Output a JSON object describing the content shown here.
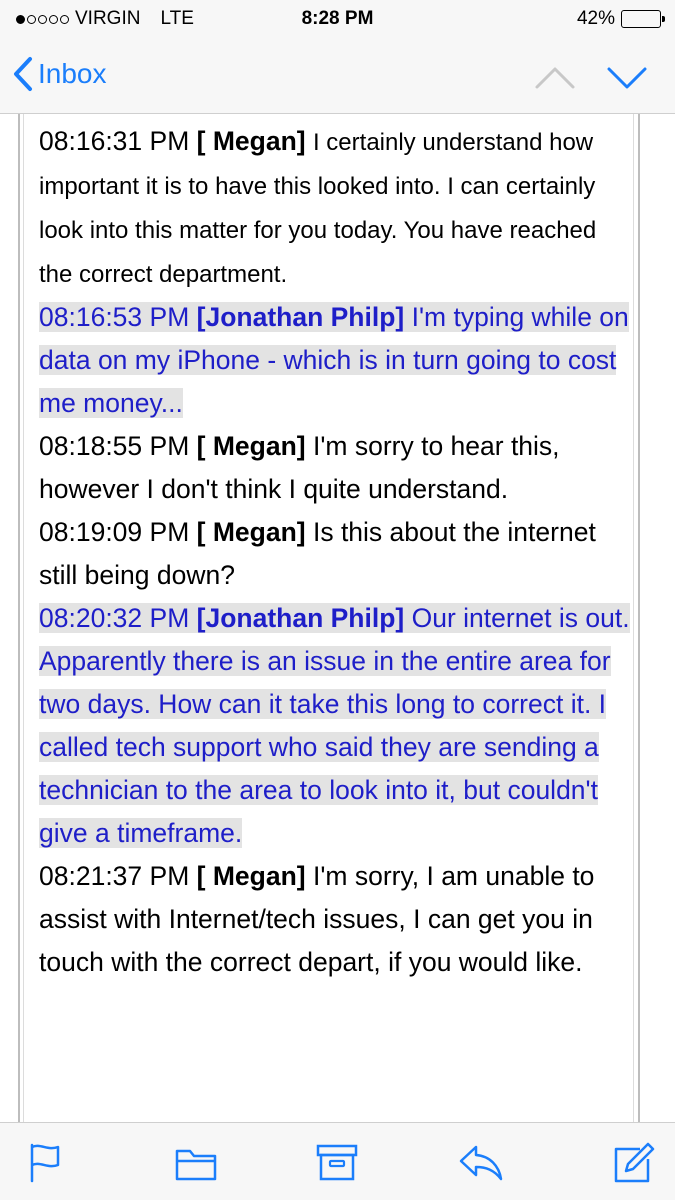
{
  "status_bar": {
    "carrier": "VIRGIN",
    "network": "LTE",
    "time": "8:28 PM",
    "battery": "42%",
    "battery_level": 0.42,
    "signal_bars_filled": 1,
    "signal_bars_total": 5
  },
  "nav": {
    "back_label": "Inbox",
    "back_icon": "chevron-left-icon",
    "up_icon": "chevron-up-icon",
    "down_icon": "chevron-down-icon",
    "accent_color": "#1b7efb"
  },
  "messages": [
    {
      "role": "agent",
      "timestamp": "08:16:31 PM",
      "sender": "[ Megan]",
      "text": "I certainly understand how important it is to have this looked into. I can certainly look into this matter for you today. You have reached the correct department."
    },
    {
      "role": "customer",
      "timestamp": "08:16:53 PM",
      "sender": "[Jonathan Philp]",
      "text": "I'm typing while on data on my iPhone - which is in turn going to cost me money..."
    },
    {
      "role": "agent",
      "timestamp": "08:18:55 PM",
      "sender": "[ Megan]",
      "text": "I'm sorry to hear this, however I don't think I quite understand."
    },
    {
      "role": "agent",
      "timestamp": "08:19:09 PM",
      "sender": "[ Megan]",
      "text": "Is this about the internet still being down?"
    },
    {
      "role": "customer",
      "timestamp": "08:20:32 PM",
      "sender": "[Jonathan Philp]",
      "text": "Our internet is out. Apparently there is an issue in the entire area for two days. How can it take this long to correct it. I called tech support who said they are sending a technician to the area to look into it, but couldn't give a timeframe."
    },
    {
      "role": "agent",
      "timestamp": "08:21:37 PM",
      "sender": "[ Megan]",
      "text": "I'm sorry, I am unable to assist with Internet/tech issues, I can get you in touch with the correct depart, if you would like."
    }
  ],
  "colors": {
    "customer_text": "#1e1ec8",
    "customer_highlight": "#e3e3e3",
    "agent_text": "#000000",
    "toolbar_icon": "#1b7efb"
  },
  "toolbar": {
    "icons": [
      "flag-icon",
      "folder-icon",
      "archive-icon",
      "reply-icon",
      "compose-icon"
    ]
  }
}
